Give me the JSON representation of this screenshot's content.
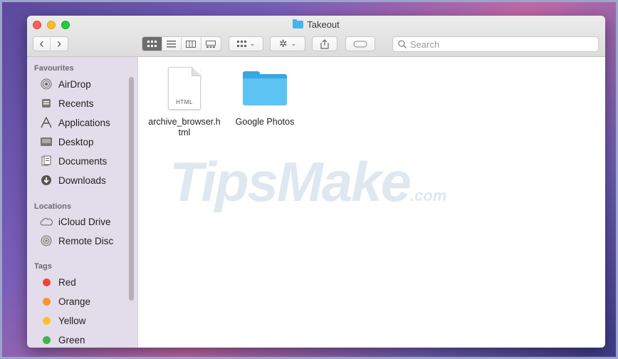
{
  "window": {
    "title": "Takeout"
  },
  "toolbar": {
    "back_glyph": "‹",
    "forward_glyph": "›",
    "view_modes": [
      "icon-view",
      "list-view",
      "column-view",
      "gallery-view"
    ],
    "search_placeholder": "Search"
  },
  "sidebar": {
    "favourites_header": "Favourites",
    "favourites": [
      {
        "label": "AirDrop",
        "icon": "airdrop-icon"
      },
      {
        "label": "Recents",
        "icon": "recents-icon"
      },
      {
        "label": "Applications",
        "icon": "applications-icon"
      },
      {
        "label": "Desktop",
        "icon": "desktop-icon"
      },
      {
        "label": "Documents",
        "icon": "documents-icon"
      },
      {
        "label": "Downloads",
        "icon": "downloads-icon"
      }
    ],
    "locations_header": "Locations",
    "locations": [
      {
        "label": "iCloud Drive",
        "icon": "cloud-icon"
      },
      {
        "label": "Remote Disc",
        "icon": "disc-icon"
      }
    ],
    "tags_header": "Tags",
    "tags": [
      {
        "label": "Red",
        "color": "#f2443d"
      },
      {
        "label": "Orange",
        "color": "#f7962b"
      },
      {
        "label": "Yellow",
        "color": "#fdc02b"
      },
      {
        "label": "Green",
        "color": "#39b54a"
      }
    ]
  },
  "files": [
    {
      "name_line1": "archive_browser.h",
      "name_line2": "tml",
      "type": "HTML"
    },
    {
      "name_line1": "Google Photos",
      "name_line2": "",
      "type": "folder"
    }
  ],
  "watermark": {
    "main": "TipsMake",
    "suffix": ".com"
  }
}
